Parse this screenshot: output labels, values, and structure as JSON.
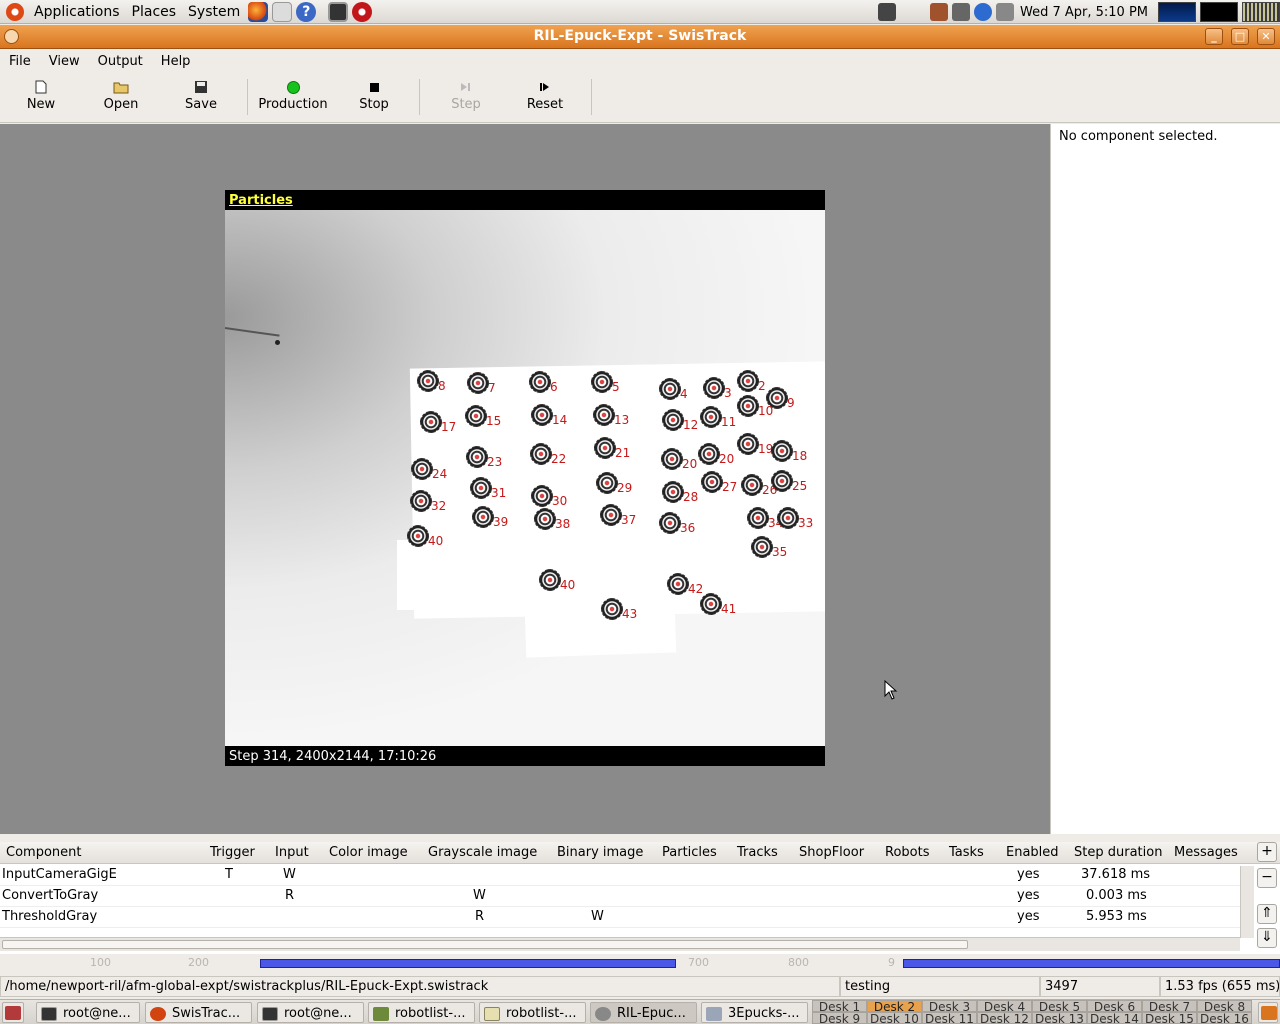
{
  "top_panel": {
    "menus": [
      "Applications",
      "Places",
      "System"
    ],
    "clock": "Wed  7 Apr,  5:10 PM"
  },
  "window": {
    "title": "RIL-Epuck-Expt - SwisTrack",
    "controls": [
      "minimize",
      "maximize",
      "close"
    ]
  },
  "menubar": [
    "File",
    "View",
    "Output",
    "Help"
  ],
  "toolbar": {
    "new": "New",
    "open": "Open",
    "save": "Save",
    "production": "Production",
    "stop": "Stop",
    "step": "Step",
    "reset": "Reset",
    "production_indicator_color": "#17c21d"
  },
  "viewer": {
    "title": "Particles",
    "status": "Step 314, 2400x2144, 17:10:26",
    "label_color": "#c41a1a",
    "particles": [
      {
        "id": "8"
      },
      {
        "id": "7"
      },
      {
        "id": "6"
      },
      {
        "id": "5"
      },
      {
        "id": "4"
      },
      {
        "id": "3"
      },
      {
        "id": "2"
      },
      {
        "id": "9"
      },
      {
        "id": "10"
      },
      {
        "id": "17"
      },
      {
        "id": "15"
      },
      {
        "id": "14"
      },
      {
        "id": "13"
      },
      {
        "id": "12"
      },
      {
        "id": "11"
      },
      {
        "id": "19"
      },
      {
        "id": "18"
      },
      {
        "id": "24"
      },
      {
        "id": "23"
      },
      {
        "id": "22"
      },
      {
        "id": "21"
      },
      {
        "id": "20"
      },
      {
        "id": "20"
      },
      {
        "id": "32"
      },
      {
        "id": "31"
      },
      {
        "id": "30"
      },
      {
        "id": "29"
      },
      {
        "id": "28"
      },
      {
        "id": "27"
      },
      {
        "id": "26"
      },
      {
        "id": "25"
      },
      {
        "id": "40"
      },
      {
        "id": "39"
      },
      {
        "id": "38"
      },
      {
        "id": "37"
      },
      {
        "id": "36"
      },
      {
        "id": "34"
      },
      {
        "id": "33"
      },
      {
        "id": "35"
      },
      {
        "id": "40"
      },
      {
        "id": "42"
      },
      {
        "id": "41"
      },
      {
        "id": "43"
      }
    ]
  },
  "side_panel": {
    "text": "No component selected."
  },
  "component_table": {
    "columns": [
      "Component",
      "Trigger",
      "Input",
      "Color image",
      "Grayscale image",
      "Binary image",
      "Particles",
      "Tracks",
      "ShopFloor",
      "Robots",
      "Tasks",
      "Enabled",
      "Step duration",
      "Messages"
    ],
    "rows": [
      {
        "component": "InputCameraGigE",
        "trigger": "T",
        "input": "W",
        "grayscale": "",
        "binary": "",
        "enabled": "yes",
        "duration": "37.618 ms"
      },
      {
        "component": "ConvertToGray",
        "trigger": "",
        "input": "R",
        "grayscale": "W",
        "binary": "",
        "enabled": "yes",
        "duration": "0.003 ms"
      },
      {
        "component": "ThresholdGray",
        "trigger": "",
        "input": "",
        "grayscale": "R",
        "binary": "W",
        "enabled": "yes",
        "duration": "5.953 ms"
      }
    ],
    "buttons": {
      "add": "+",
      "remove": "−",
      "up": "⇑",
      "down": "⇓"
    }
  },
  "timeline": {
    "ticks": [
      "100",
      "200",
      "700",
      "800",
      "9"
    ]
  },
  "statusbar": {
    "path": "/home/newport-ril/afm-global-expt/swistrackplus/RIL-Epuck-Expt.swistrack",
    "mode": "testing",
    "step": "3497",
    "fps": "1.53 fps (655 ms)"
  },
  "taskbar": {
    "tasks": [
      "root@ne...",
      "SwisTrac...",
      "root@ne...",
      "robotlist-...",
      "robotlist-...",
      "RIL-Epuc...",
      "3Epucks-..."
    ],
    "desks_row1": [
      "Desk 1",
      "Desk 2",
      "Desk 3",
      "Desk 4",
      "Desk 5",
      "Desk 6",
      "Desk 7",
      "Desk 8"
    ],
    "desks_row2": [
      "Desk 9",
      "Desk 10",
      "Desk 11",
      "Desk 12",
      "Desk 13",
      "Desk 14",
      "Desk 15",
      "Desk 16"
    ],
    "active_desk": "Desk 2"
  }
}
